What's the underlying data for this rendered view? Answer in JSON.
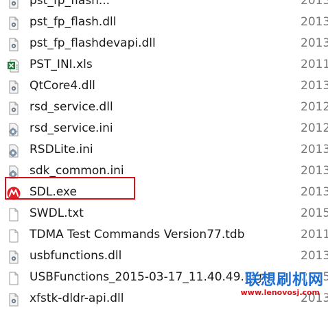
{
  "files": [
    {
      "name": "pst_fp_flash...",
      "date": "2013",
      "icon": "dll-file-icon"
    },
    {
      "name": "pst_fp_flash.dll",
      "date": "2013",
      "icon": "dll-file-icon"
    },
    {
      "name": "pst_fp_flashdevapi.dll",
      "date": "2013",
      "icon": "dll-file-icon"
    },
    {
      "name": "PST_INI.xls",
      "date": "2011",
      "icon": "excel-file-icon"
    },
    {
      "name": "QtCore4.dll",
      "date": "2013",
      "icon": "dll-file-icon"
    },
    {
      "name": "rsd_service.dll",
      "date": "2012",
      "icon": "dll-file-icon"
    },
    {
      "name": "rsd_service.ini",
      "date": "2012",
      "icon": "ini-file-icon"
    },
    {
      "name": "RSDLite.ini",
      "date": "2013",
      "icon": "ini-file-icon"
    },
    {
      "name": "sdk_common.ini",
      "date": "2013",
      "icon": "ini-file-icon"
    },
    {
      "name": "SDL.exe",
      "date": "2013",
      "icon": "motorola-logo-icon"
    },
    {
      "name": "SWDL.txt",
      "date": "2015",
      "icon": "text-file-icon"
    },
    {
      "name": "TDMA Test Commands Version77.tdb",
      "date": "2011",
      "icon": "generic-file-icon"
    },
    {
      "name": "usbfunctions.dll",
      "date": "2013",
      "icon": "dll-file-icon"
    },
    {
      "name": "USBFunctions_2015-03-17_11.40.49.log",
      "date": "2015",
      "icon": "generic-file-icon"
    },
    {
      "name": "xfstk-dldr-api.dll",
      "date": "2013",
      "icon": "dll-file-icon"
    }
  ],
  "highlighted_file": "SDL.exe",
  "watermark": {
    "title": "联想刷机网",
    "url": "www.lenovosj.com"
  },
  "colors": {
    "highlight": "#d5121a",
    "watermark_text": "#1e6fd1"
  }
}
